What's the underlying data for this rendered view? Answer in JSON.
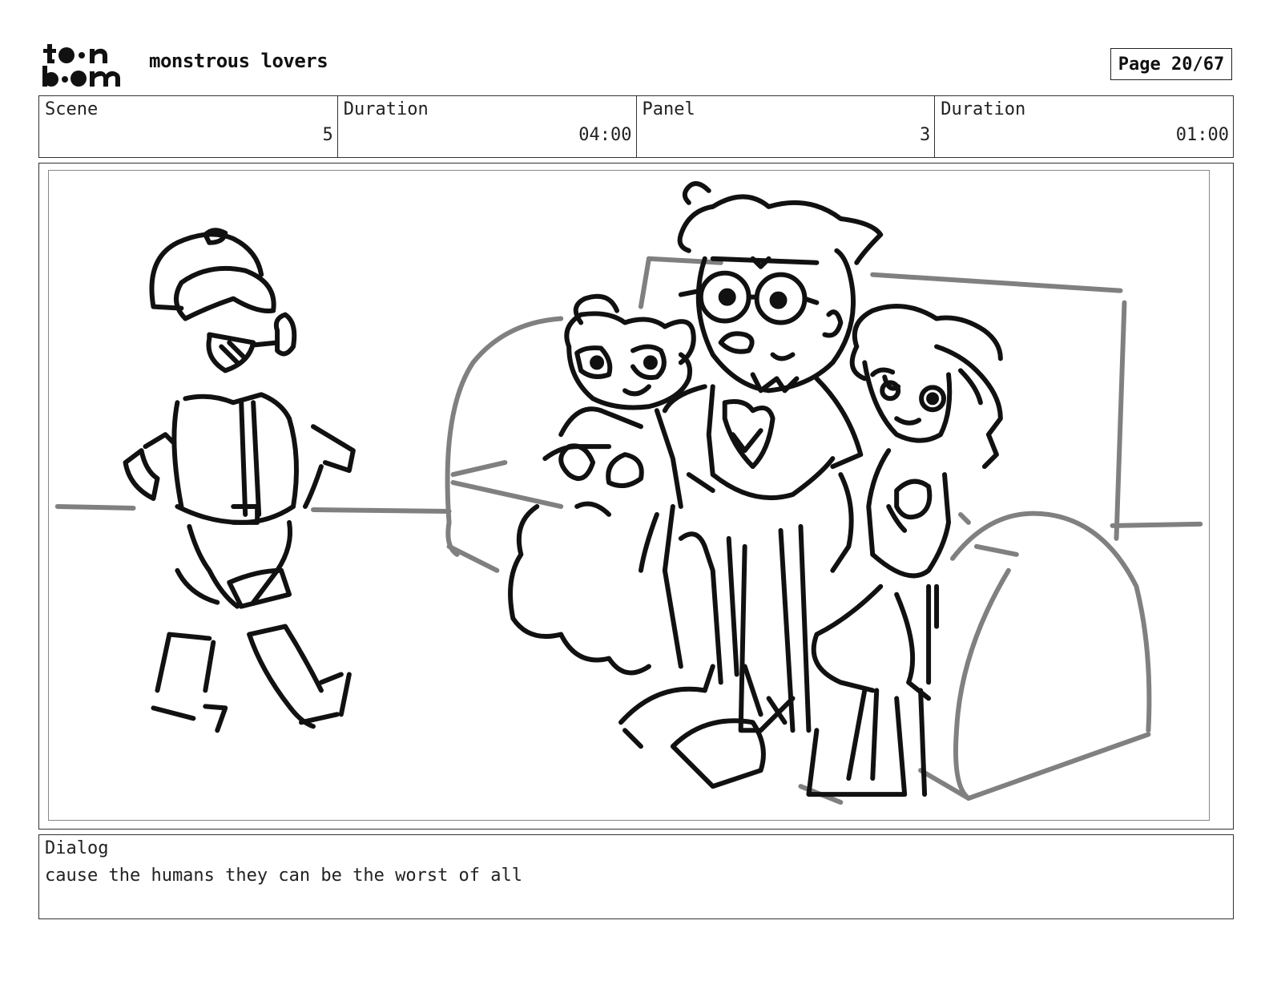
{
  "header": {
    "logo_text": "toon boom",
    "project_title": "monstrous lovers",
    "page_indicator": "Page 20/67"
  },
  "info": {
    "scene_label": "Scene",
    "scene_value": "5",
    "scene_duration_label": "Duration",
    "scene_duration_value": "04:00",
    "panel_label": "Panel",
    "panel_value": "3",
    "panel_duration_label": "Duration",
    "panel_duration_value": "01:00"
  },
  "dialog": {
    "label": "Dialog",
    "text": "cause the humans they can be the worst of all"
  }
}
